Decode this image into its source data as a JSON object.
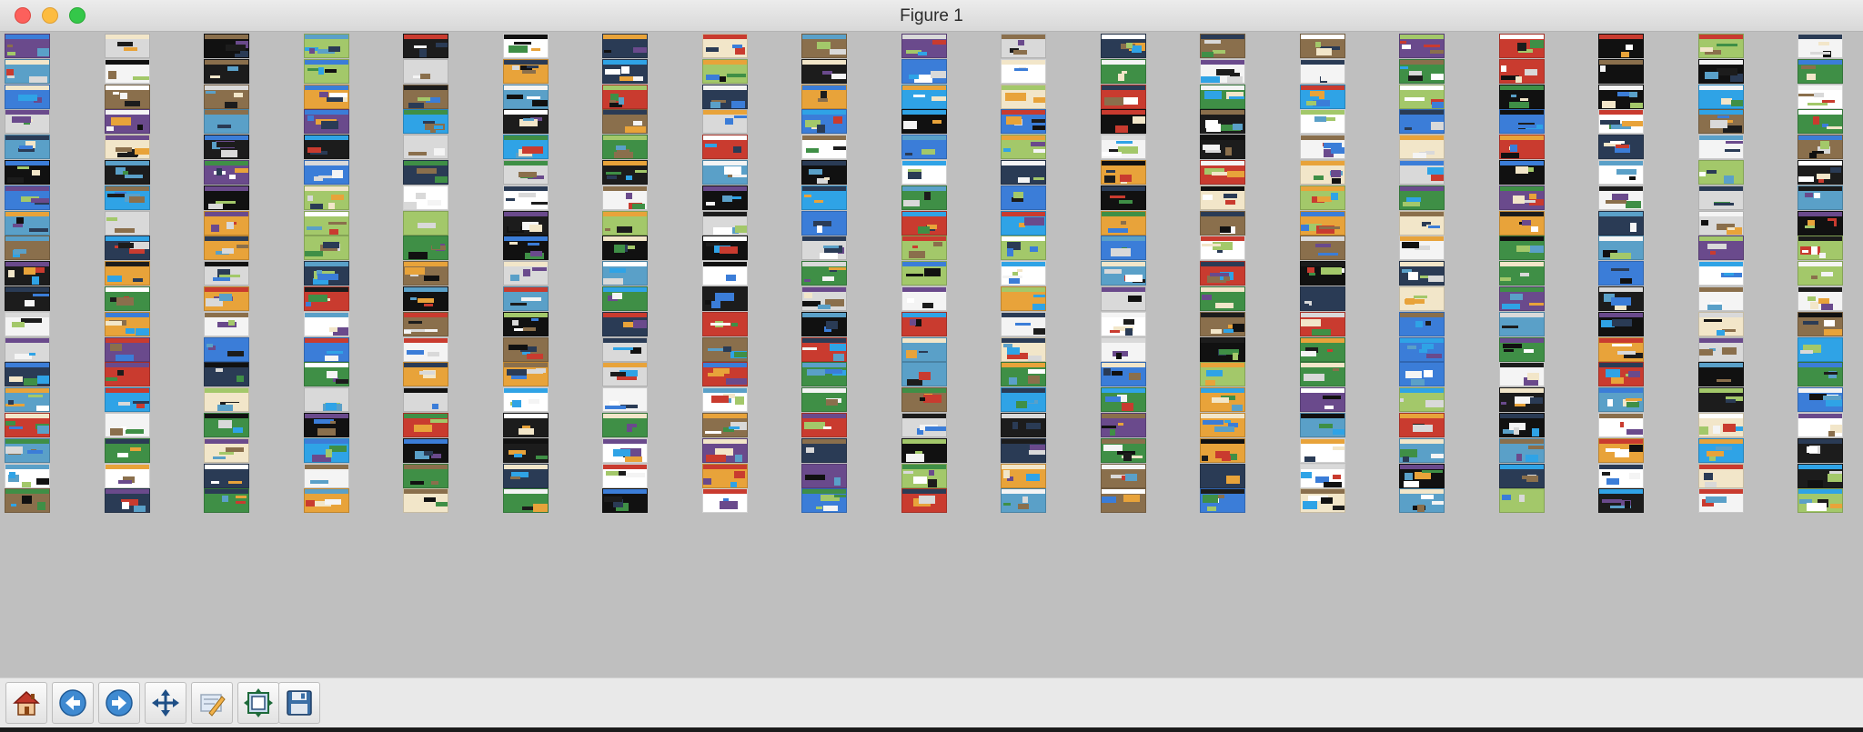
{
  "window": {
    "title": "Figure 1"
  },
  "toolbar": {
    "buttons": [
      {
        "name": "home-button",
        "icon": "home-icon"
      },
      {
        "name": "back-button",
        "icon": "back-arrow-icon"
      },
      {
        "name": "forward-button",
        "icon": "forward-arrow-icon"
      },
      {
        "name": "pan-button",
        "icon": "pan-arrows-icon"
      },
      {
        "name": "zoom-button",
        "icon": "zoom-rect-icon"
      },
      {
        "name": "subplots-button",
        "icon": "subplots-icon"
      },
      {
        "name": "save-button",
        "icon": "save-disk-icon"
      }
    ]
  },
  "grid": {
    "columns": 19,
    "rows": 19
  },
  "colors": {
    "canvas_bg": "#bfbfbf",
    "palette": [
      "#ffffff",
      "#f4f4f4",
      "#1c1c1c",
      "#2a3b55",
      "#3b7dd8",
      "#2fa3e6",
      "#c93b2f",
      "#e8a33a",
      "#3f8f46",
      "#6a4a8c",
      "#8a6f4c",
      "#d9d9d9",
      "#f2e6c9",
      "#111111",
      "#5aa0c8",
      "#a3c86a"
    ]
  }
}
